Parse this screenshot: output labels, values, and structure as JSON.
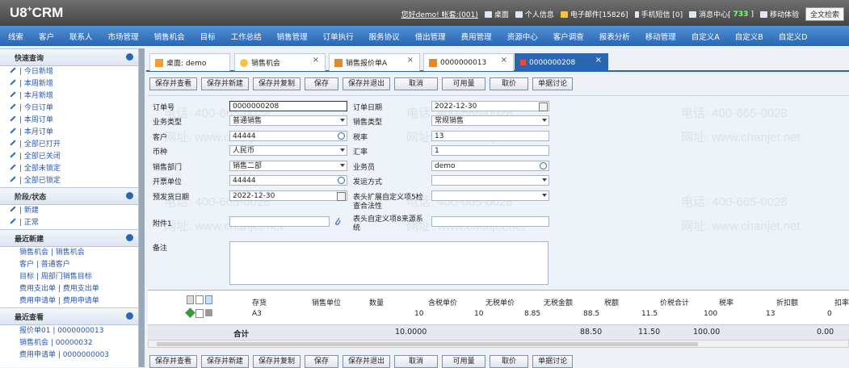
{
  "app": {
    "logo": "U8",
    "logo_sup": "+",
    "logo_tail": "CRM"
  },
  "top_links": {
    "greeting": "您好demo! 帐套:(001)",
    "desktop": "桌面",
    "personal": "个人信息",
    "email": "电子邮件[15826]",
    "sms": "手机短信 [0]",
    "msg_prefix": "消息中心[",
    "msg_count": "733",
    "msg_suffix": "]",
    "mobile": "移动体验",
    "search": "全文检索"
  },
  "nav": [
    "线索",
    "客户",
    "联系人",
    "市场管理",
    "销售机会",
    "目标",
    "工作总结",
    "销售管理",
    "订单执行",
    "服务协议",
    "借出管理",
    "费用管理",
    "资源中心",
    "客户调查",
    "报表分析",
    "移动管理",
    "自定义A",
    "自定义B",
    "自定义D"
  ],
  "sidebar": {
    "quick": {
      "title": "快速查询",
      "items": [
        "| 今日新增",
        "| 本周新增",
        "| 本月新增",
        "| 今日订单",
        "| 本周订单",
        "| 本月订单",
        "| 全部已打开",
        "| 全部已关闭",
        "| 全部未锁定",
        "| 全部已锁定"
      ]
    },
    "stage": {
      "title": "阶段/状态",
      "items": [
        "| 新建",
        "| 正常"
      ]
    },
    "recent_new": {
      "title": "最近新建",
      "items": [
        "销售机会 | 销售机会",
        "客户 | 普通客户",
        "目标 | 周部门销售目标",
        "费用支出单 | 费用支出单",
        "费用申请单 | 费用申请单"
      ]
    },
    "recent_view": {
      "title": "最近查看",
      "items": [
        "报价单01 | 0000000013",
        "销售机会 | 00000032",
        "费用申请单 | 0000000003"
      ]
    }
  },
  "tabs": [
    {
      "label": "桌面: demo",
      "icon": "home-icon"
    },
    {
      "label": "销售机会",
      "icon": "opportunity-icon",
      "close": "×"
    },
    {
      "label": "销售报价单A",
      "icon": "quote-icon",
      "close": "×"
    },
    {
      "label": "0000000013",
      "icon": "document-icon",
      "close": "×"
    },
    {
      "label": "0000000208",
      "icon": "document-icon",
      "close": "×"
    }
  ],
  "toolbar": [
    "保存并查看",
    "保存并新建",
    "保存并复制",
    "保存",
    "保存并退出",
    "取消",
    "可用量",
    "取价",
    "单据讨论"
  ],
  "form": {
    "order_no_label": "订单号",
    "order_no": "0000000208",
    "order_date_label": "订单日期",
    "order_date": "2022-12-30",
    "biz_type_label": "业务类型",
    "biz_type": "普通销售",
    "sale_type_label": "销售类型",
    "sale_type": "常规销售",
    "customer_label": "客户",
    "customer": "44444",
    "tax_label": "税率",
    "tax": "13",
    "currency_label": "币种",
    "currency": "人民币",
    "rate_label": "汇率",
    "rate": "1",
    "dept_label": "销售部门",
    "dept": "销售二部",
    "salesman_label": "业务员",
    "salesman": "demo",
    "invoice_unit_label": "开票单位",
    "invoice_unit": "44444",
    "ship_label": "发运方式",
    "ship": "",
    "ship_date_label": "预发货日期",
    "ship_date": "2022-12-30",
    "ext5_label": "表头扩展自定义项5检查合法性",
    "attach_label": "附件1",
    "ext8_label": "表头自定义项8来源系统",
    "memo_label": "备注"
  },
  "grid": {
    "headers": [
      "存货",
      "销售单位",
      "数量",
      "含税单价",
      "无税单价",
      "无税金额",
      "税额",
      "价税合计",
      "税率",
      "折扣额",
      "扣率"
    ],
    "row": [
      "A3",
      "",
      "10",
      "10",
      "8.85",
      "88.5",
      "11.5",
      "100",
      "13",
      "0"
    ],
    "total_label": "合计",
    "totals": {
      "qty": "10.0000",
      "amount": "88.50",
      "tax": "11.50",
      "sum": "100.00",
      "discount": "0.00"
    }
  },
  "watermarks": {
    "phone": "电话: 400-665-0028",
    "site": "网址: www.chanjet.net"
  },
  "colors": {
    "nav": "#2b66b2",
    "topbar": "#555555",
    "msg_count": "#7CFC7C"
  }
}
